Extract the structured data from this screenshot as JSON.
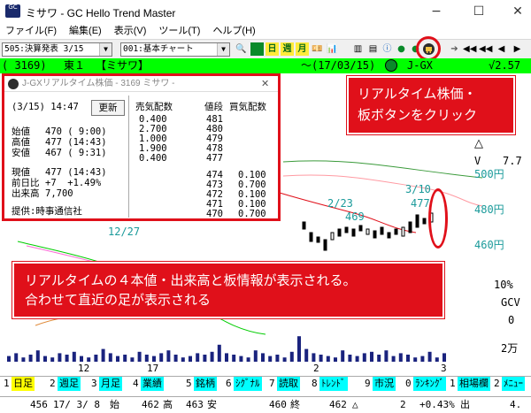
{
  "window": {
    "title": "ミサワ - GC Hello Trend Master",
    "icon_label": "GC",
    "min": "−",
    "max": "☐",
    "close": "✕"
  },
  "menu": [
    {
      "label": "ファイル(F)"
    },
    {
      "label": "編集(E)"
    },
    {
      "label": "表示(V)"
    },
    {
      "label": "ツール(T)"
    },
    {
      "label": "ヘルプ(H)"
    }
  ],
  "toolbar": {
    "issue_select": "505:決算発表 3/15",
    "chart_select": "001:基本チャート",
    "period_buttons": [
      "日",
      "週",
      "月"
    ]
  },
  "header": {
    "code": "( 3169)",
    "market": "東１",
    "name": "【ミサワ】",
    "date": "〜(17/03/15)",
    "index": "J-GX",
    "ratio": "√2.57"
  },
  "chart": {
    "axis_labels": [
      "500円",
      "480円",
      "460円",
      "10%",
      "GCV",
      "0",
      "2万"
    ],
    "annotations": {
      "p1_date": "2/23",
      "p1_price": "469",
      "p2_date": "3/10",
      "p2_price": "477",
      "ma_label": "12/27",
      "side_v": "V",
      "side_triangle": "△",
      "side_price": "7.7"
    },
    "x_labels": [
      "12",
      "17",
      "2",
      "3"
    ]
  },
  "popup": {
    "title": "J-GXリアルタイム株価 - 3169 ミサワ -",
    "close": "✕",
    "timestamp": "(3/15) 14:47",
    "refresh_button": "更新",
    "quote_rows": [
      {
        "label": "始値",
        "value": "470 ( 9:00)"
      },
      {
        "label": "高値",
        "value": "477 (14:43)"
      },
      {
        "label": "安値",
        "value": "467 ( 9:31)"
      },
      {
        "label": "現値",
        "value": "477 (14:43)"
      },
      {
        "label": "前日比",
        "value": "+7  +1.49%"
      },
      {
        "label": "出来高",
        "value": "7,700"
      }
    ],
    "provider": "提供:時事通信社",
    "board_headers": {
      "sell": "売気配数",
      "price": "値段",
      "buy": "買気配数"
    },
    "board_rows": [
      {
        "sell": "0.400",
        "price": "481",
        "buy": ""
      },
      {
        "sell": "2.700",
        "price": "480",
        "buy": ""
      },
      {
        "sell": "1.000",
        "price": "479",
        "buy": ""
      },
      {
        "sell": "1.900",
        "price": "478",
        "buy": ""
      },
      {
        "sell": "0.400",
        "price": "477",
        "buy": ""
      },
      {
        "sell": "",
        "price": "474",
        "buy": "0.100"
      },
      {
        "sell": "",
        "price": "473",
        "buy": "0.700"
      },
      {
        "sell": "",
        "price": "472",
        "buy": "0.100"
      },
      {
        "sell": "",
        "price": "471",
        "buy": "0.100"
      },
      {
        "sell": "",
        "price": "470",
        "buy": "0.700"
      }
    ]
  },
  "callout_top": {
    "line1": "リアルタイム株価・",
    "line2": "板ボタンをクリック"
  },
  "callout_bottom": {
    "line1": "リアルタイムの４本値・出来高と板情報が表示される。",
    "line2": "合わせて直近の足が表示される"
  },
  "tabs": [
    {
      "num": "1",
      "label": "日足",
      "selected": true
    },
    {
      "num": "2",
      "label": "週足"
    },
    {
      "num": "3",
      "label": "月足"
    },
    {
      "num": "4",
      "label": "業績"
    },
    {
      "num": "5",
      "label": "銘柄"
    },
    {
      "num": "6",
      "label": "ｼｸﾞﾅﾙ"
    },
    {
      "num": "7",
      "label": "読取"
    },
    {
      "num": "8",
      "label": "ﾄﾚﾝﾄﾞ"
    },
    {
      "num": "9",
      "label": "市況"
    },
    {
      "num": "0",
      "label": "ﾗﾝｷﾝｸﾞ"
    },
    {
      "num": "1",
      "label": "相場欄"
    },
    {
      "num": "2",
      "label": "ﾒﾆｭｰ"
    }
  ],
  "status": {
    "a": "456",
    "date": "17/ 3/ 8",
    "open_label": "始",
    "open": "462",
    "high_label": "高",
    "high": "463",
    "low_label": "安",
    "low": "460",
    "close_label": "終",
    "close": "462",
    "chg_sym": "△",
    "chg": "2",
    "pct": "+0.43%",
    "out": "出",
    "tail": "4."
  },
  "colors": {
    "accent_red": "#e0101a",
    "header_green": "#00ff00",
    "tab_cyan": "#00ffff",
    "tab_selected": "#ffff00",
    "volume": "#1a237e"
  }
}
